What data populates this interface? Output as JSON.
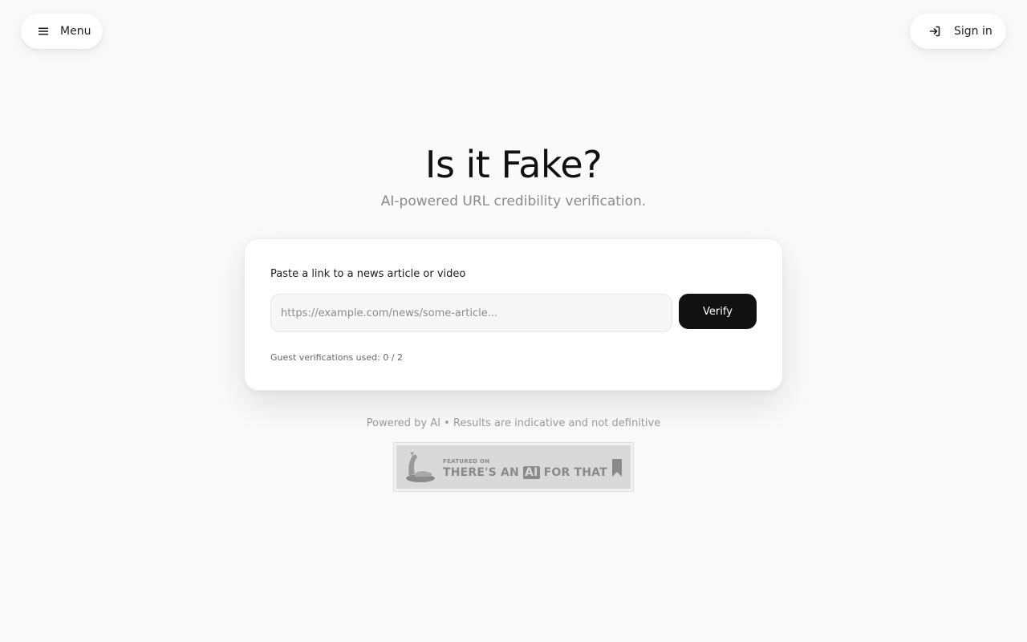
{
  "nav": {
    "menu_label": "Menu",
    "signin_label": "Sign in"
  },
  "hero": {
    "title": "Is it Fake?",
    "subtitle": "AI-powered URL credibility verification."
  },
  "form": {
    "label": "Paste a link to a news article or video",
    "url_placeholder": "https://example.com/news/some-article...",
    "url_value": "",
    "verify_label": "Verify",
    "usage_text": "Guest verifications used: 0 / 2"
  },
  "footer": {
    "note": "Powered by AI • Results are indicative and not definitive",
    "badge": {
      "small_text": "FEATURED ON",
      "big_text_pre": "THERE'S AN",
      "big_text_ai": "AI",
      "big_text_post": "FOR THAT"
    }
  },
  "icons": {
    "menu": "hamburger-icon",
    "signin": "sign-in-icon",
    "badge_logo": "robot-arm-icon",
    "badge_bookmark": "bookmark-icon"
  },
  "colors": {
    "background": "#fafafa",
    "primary_button": "#111111",
    "muted_text": "#8a8a8a"
  }
}
